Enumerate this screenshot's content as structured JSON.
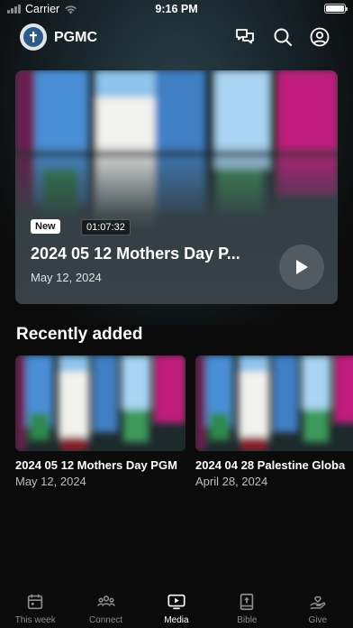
{
  "status_bar": {
    "carrier": "Carrier",
    "time": "9:16 PM"
  },
  "header": {
    "brand": "PGMC",
    "icons": [
      "chat-icon",
      "search-icon",
      "profile-icon"
    ]
  },
  "hero": {
    "badge_new": "New",
    "duration": "01:07:32",
    "title": "2024 05 12 Mothers Day P...",
    "date": "May 12, 2024"
  },
  "recently_added": {
    "heading": "Recently added",
    "items": [
      {
        "title": "2024 05 12 Mothers Day PGM",
        "date": "May 12, 2024"
      },
      {
        "title": "2024 04 28 Palestine Globa",
        "date": "April 28, 2024"
      }
    ]
  },
  "tabbar": {
    "tabs": [
      {
        "label": "This week",
        "icon": "calendar-icon"
      },
      {
        "label": "Connect",
        "icon": "people-icon"
      },
      {
        "label": "Media",
        "icon": "media-icon",
        "active": true
      },
      {
        "label": "Bible",
        "icon": "bible-icon"
      },
      {
        "label": "Give",
        "icon": "give-icon"
      }
    ]
  },
  "colors": {
    "background": "#0b0b0b",
    "card": "#38424a",
    "inactive_tab": "#8c8c8c",
    "active_tab": "#ffffff"
  }
}
